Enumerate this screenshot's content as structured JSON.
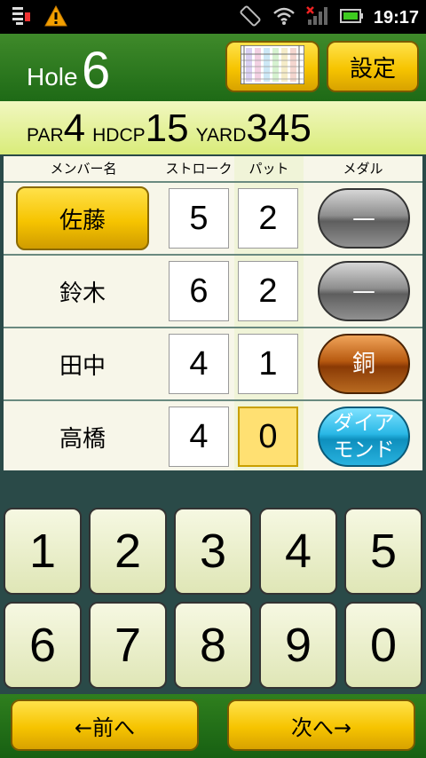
{
  "status": {
    "time": "19:17"
  },
  "header": {
    "hole_label": "Hole",
    "hole_number": "6",
    "settings_label": "設定"
  },
  "info": {
    "par_label": "PAR",
    "par_value": "4",
    "hdcp_label": "HDCP",
    "hdcp_value": "15",
    "yard_label": "YARD",
    "yard_value": "345"
  },
  "table": {
    "headers": {
      "member": "メンバー名",
      "stroke": "ストローク",
      "putt": "パット",
      "medal": "メダル"
    },
    "rows": [
      {
        "name": "佐藤",
        "stroke": "5",
        "putt": "2",
        "medal": "—"
      },
      {
        "name": "鈴木",
        "stroke": "6",
        "putt": "2",
        "medal": "—"
      },
      {
        "name": "田中",
        "stroke": "4",
        "putt": "1",
        "medal": "銅"
      },
      {
        "name": "高橋",
        "stroke": "4",
        "putt": "0",
        "medal_line1": "ダイア",
        "medal_line2": "モンド"
      }
    ]
  },
  "keypad": {
    "keys": [
      "1",
      "2",
      "3",
      "4",
      "5",
      "6",
      "7",
      "8",
      "9",
      "0"
    ]
  },
  "nav": {
    "prev_label": "←前へ",
    "next_label": "次へ→"
  },
  "colors": {
    "header_green": "#2e7a20",
    "button_yellow": "#f6c400",
    "info_bar": "#e4f09a",
    "background": "#2a4a48"
  },
  "icons": [
    "sim-toolkit-icon",
    "warning-icon",
    "rotate-icon",
    "wifi-icon",
    "signal-icon",
    "battery-icon",
    "scorecard-icon"
  ]
}
